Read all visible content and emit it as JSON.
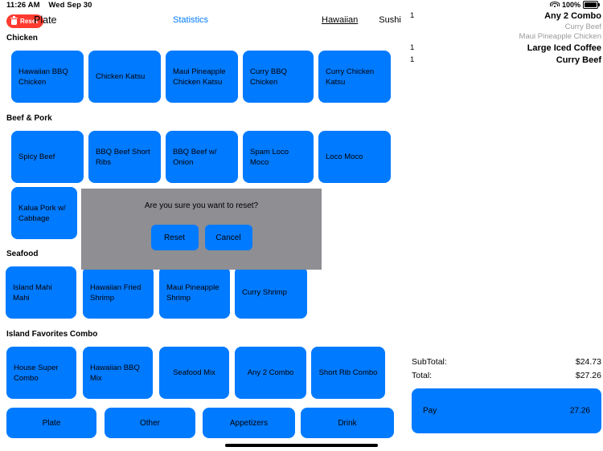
{
  "status_bar": {
    "time": "11:26 AM",
    "date": "Wed Sep 30",
    "battery_percent": "100%",
    "wifi_icon": "wifi-icon",
    "battery_icon": "battery-icon"
  },
  "header": {
    "reset_label": "Reset",
    "trash_icon": "trash-icon",
    "title": "Plate",
    "statistics_label": "Statistics",
    "category_tabs": [
      {
        "label": "Hawaiian",
        "active": true
      },
      {
        "label": "Sushi",
        "active": false
      }
    ]
  },
  "menu": {
    "sections": [
      {
        "title": "Chicken",
        "items": [
          "Hawaiian BBQ Chicken",
          "Chicken Katsu",
          "Maui Pineapple Chicken Katsu",
          "Curry BBQ Chicken",
          "Curry Chicken Katsu"
        ]
      },
      {
        "title": "Beef & Pork",
        "items": [
          "Spicy Beef",
          "BBQ Beef Short Ribs",
          "BBQ Beef w/ Onion",
          "Spam Loco Moco",
          "Loco Moco",
          "Kalua Pork w/ Cabbage"
        ]
      },
      {
        "title": "Seafood",
        "items": [
          "Island Mahi Mahi",
          "Hawaiian Fried Shrimp",
          "Maui Pineapple Shrimp",
          "Curry Shrimp"
        ]
      },
      {
        "title": "Island Favorites Combo",
        "items": [
          "House Super Combo",
          "Hawaiian BBQ Mix",
          "Seafood Mix",
          "Any 2 Combo",
          "Short Rib Combo"
        ]
      }
    ]
  },
  "tab_bar": {
    "tabs": [
      "Plate",
      "Other",
      "Appetizers",
      "Drink"
    ]
  },
  "order": {
    "lines": [
      {
        "qty": "1",
        "name": "Any 2 Combo",
        "sub_items": [
          "Curry Beef",
          "Maui Pineapple Chicken"
        ]
      },
      {
        "qty": "1",
        "name": "Large Iced Coffee",
        "sub_items": []
      },
      {
        "qty": "1",
        "name": "Curry Beef",
        "sub_items": []
      }
    ]
  },
  "totals": {
    "subtotal_label": "SubTotal:",
    "subtotal_value": "$24.73",
    "total_label": "Total:",
    "total_value": "$27.26",
    "pay_label": "Pay",
    "pay_amount": "27.26"
  },
  "modal": {
    "message": "Are you sure you want to reset?",
    "confirm_label": "Reset",
    "cancel_label": "Cancel"
  },
  "colors": {
    "accent_blue": "#007AFF",
    "reset_red": "#FF3B30",
    "modal_gray": "#8E8E93",
    "sub_item_gray": "#9A9A9A"
  }
}
